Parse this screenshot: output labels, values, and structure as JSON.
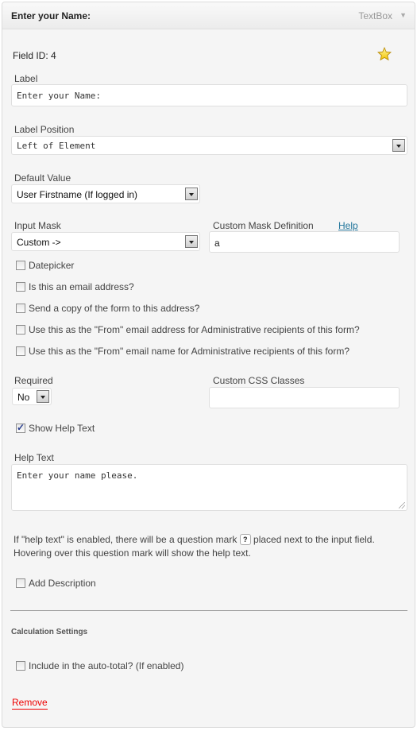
{
  "header": {
    "title": "Enter your Name:",
    "type": "TextBox"
  },
  "field_id": "Field ID: 4",
  "label": {
    "caption": "Label",
    "value": "Enter your Name:"
  },
  "label_position": {
    "caption": "Label Position",
    "value": "Left of Element"
  },
  "default_value": {
    "caption": "Default Value",
    "value": "User Firstname (If logged in)"
  },
  "input_mask": {
    "caption": "Input Mask",
    "value": "Custom ->"
  },
  "custom_mask": {
    "caption": "Custom Mask Definition",
    "help_link": "Help",
    "value": "a"
  },
  "checkboxes": [
    {
      "label": "Datepicker",
      "checked": false
    },
    {
      "label": "Is this an email address?",
      "checked": false
    },
    {
      "label": "Send a copy of the form to this address?",
      "checked": false
    },
    {
      "label": "Use this as the \"From\" email address for Administrative recipients of this form?",
      "checked": false
    },
    {
      "label": "Use this as the \"From\" email name for Administrative recipients of this form?",
      "checked": false
    }
  ],
  "required": {
    "caption": "Required",
    "value": "No"
  },
  "custom_css": {
    "caption": "Custom CSS Classes",
    "value": ""
  },
  "show_help_text": {
    "label": "Show Help Text",
    "checked": true
  },
  "help_text": {
    "caption": "Help Text",
    "value": "Enter your name please."
  },
  "help_note": {
    "part1": "If \"help text\" is enabled, there will be a question mark",
    "qmark": "?",
    "part2": "placed next to the input field.",
    "line2": "Hovering over this question mark will show the help text."
  },
  "add_description": {
    "label": "Add Description",
    "checked": false
  },
  "calculation": {
    "title": "Calculation Settings",
    "auto_total": {
      "label": "Include in the auto-total? (If enabled)",
      "checked": false
    }
  },
  "remove_label": "Remove"
}
